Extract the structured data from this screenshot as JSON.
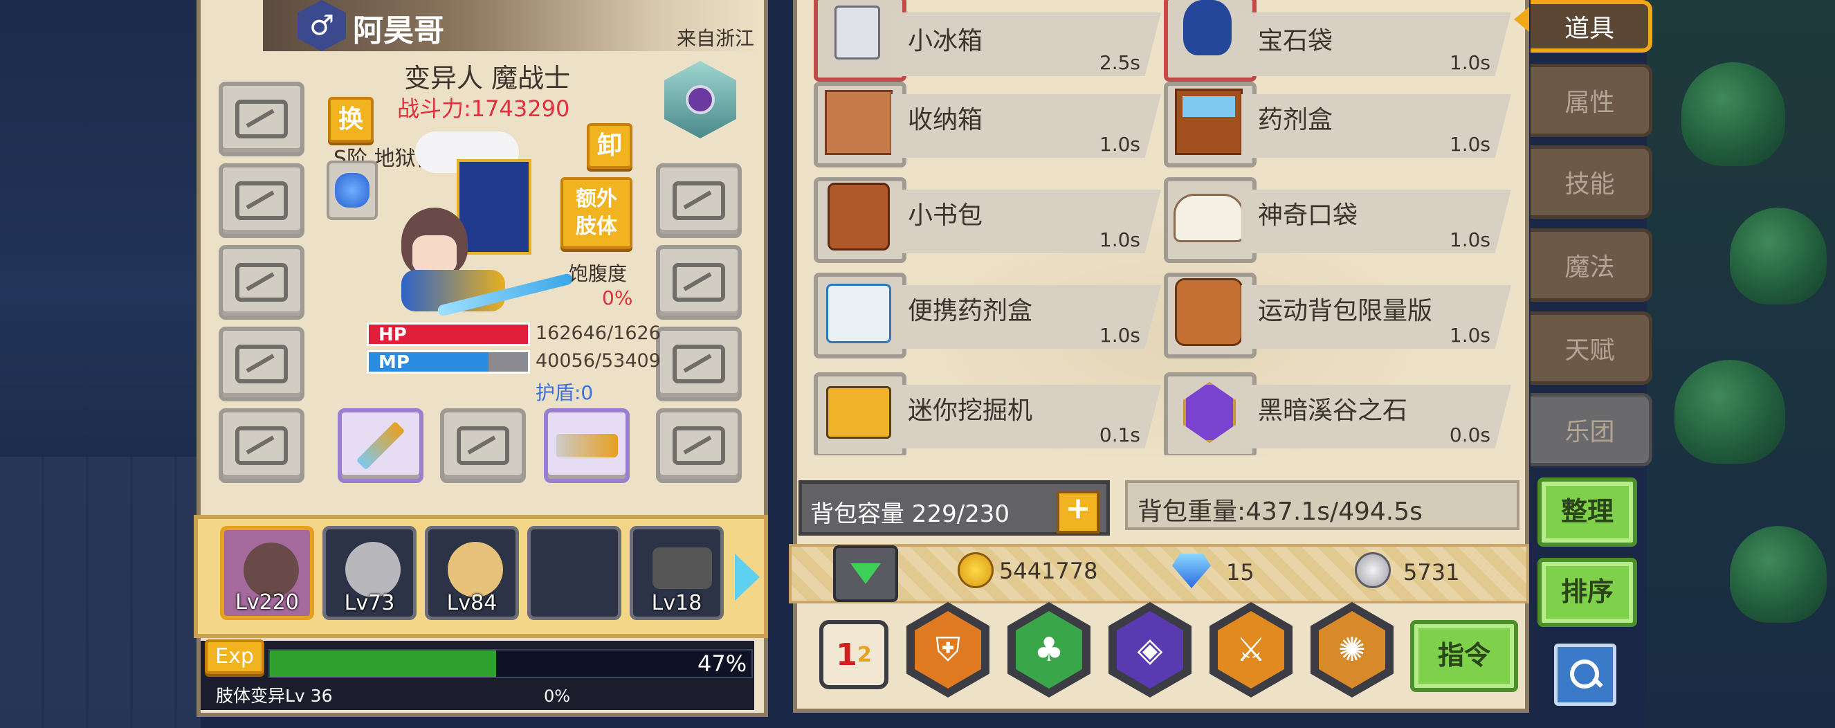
{
  "character": {
    "name": "阿昊哥",
    "origin": "来自浙江",
    "title": "变异人 魔战士",
    "power_label": "战斗力:1743290",
    "subtitle": "S阶 地狱使者 100",
    "swap_btn": "换",
    "unequip_btn": "卸",
    "extra_limb_btn": "额外\n肢体",
    "satiety_label": "饱腹度",
    "satiety_value": "0%",
    "hp_label": "HP",
    "hp_value": "162646/1626",
    "hp_fraction": 1.0,
    "mp_label": "MP",
    "mp_value": "40056/53409",
    "mp_fraction": 0.75,
    "shield_label": "护盾:0"
  },
  "party": [
    {
      "level": "Lv220",
      "selected": true
    },
    {
      "level": "Lv73",
      "selected": false
    },
    {
      "level": "Lv84",
      "selected": false
    },
    {
      "level": "",
      "selected": false
    },
    {
      "level": "Lv18",
      "selected": false
    }
  ],
  "exp": {
    "label": "Exp",
    "percent": "47%",
    "fraction": 0.47,
    "limb_label": "肢体变异Lv 36",
    "limb_percent": "0%"
  },
  "inventory": {
    "items": [
      {
        "name": "小冰箱",
        "time": "2.5s",
        "icon": "fridge-icon"
      },
      {
        "name": "宝石袋",
        "time": "1.0s",
        "icon": "gem-bag-icon"
      },
      {
        "name": "收纳箱",
        "time": "1.0s",
        "icon": "storage-box-icon"
      },
      {
        "name": "药剂盒",
        "time": "1.0s",
        "icon": "potion-box-icon"
      },
      {
        "name": "小书包",
        "time": "1.0s",
        "icon": "schoolbag-icon"
      },
      {
        "name": "神奇口袋",
        "time": "1.0s",
        "icon": "magic-pocket-icon"
      },
      {
        "name": "便携药剂盒",
        "time": "1.0s",
        "icon": "medkit-icon"
      },
      {
        "name": "运动背包限量版",
        "time": "1.0s",
        "icon": "sport-backpack-icon"
      },
      {
        "name": "迷你挖掘机",
        "time": "0.1s",
        "icon": "excavator-icon"
      },
      {
        "name": "黑暗溪谷之石",
        "time": "0.0s",
        "icon": "dark-stone-icon"
      }
    ],
    "capacity_label": "背包容量 229/230",
    "weight_label": "背包重量:437.1s/494.5s"
  },
  "currency": {
    "gold": "5441778",
    "diamond": "15",
    "silver": "5731"
  },
  "bottom": {
    "command_btn": "指令",
    "skill_icons": [
      "swap-order-icon",
      "shield-crest-icon",
      "tree-icon",
      "rune-shield-icon",
      "sword-buff-icon",
      "pinwheel-icon"
    ]
  },
  "tabs": [
    "道具",
    "属性",
    "技能",
    "魔法",
    "天赋",
    "乐团"
  ],
  "side_buttons": {
    "sort_btn": "整理",
    "order_btn": "排序"
  },
  "colors": {
    "accent_gold": "#f1b420",
    "hp_red": "#e0203a",
    "mp_blue": "#2a8ce0",
    "exp_green": "#2fa12f",
    "power_red": "#e0303c"
  }
}
